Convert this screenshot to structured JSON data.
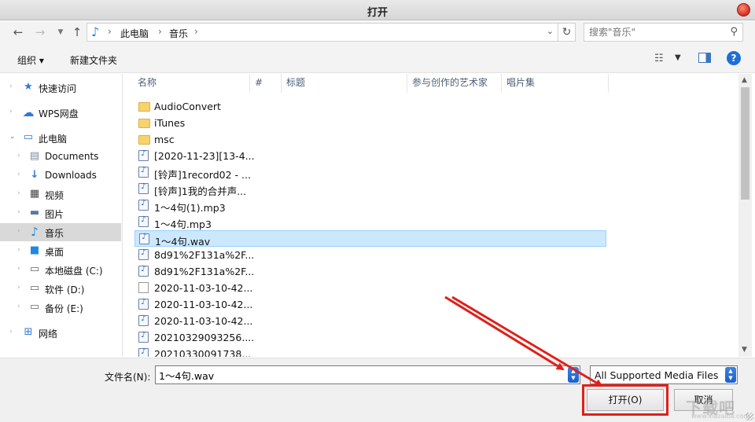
{
  "window": {
    "title": "打开"
  },
  "addressbar": {
    "crumbs": [
      "此电脑",
      "音乐"
    ],
    "search_placeholder": "搜索\"音乐\""
  },
  "toolbar": {
    "organize": "组织 ▾",
    "new_folder": "新建文件夹"
  },
  "nav": {
    "items": [
      {
        "label": "快速访问",
        "icon": "star-icon"
      },
      {
        "label": "WPS网盘",
        "icon": "cloud-icon"
      },
      {
        "label": "此电脑",
        "icon": "computer-icon"
      },
      {
        "label": "Documents",
        "icon": "document-icon"
      },
      {
        "label": "Downloads",
        "icon": "download-icon"
      },
      {
        "label": "视频",
        "icon": "video-icon"
      },
      {
        "label": "图片",
        "icon": "picture-icon"
      },
      {
        "label": "音乐",
        "icon": "music-icon",
        "selected": true
      },
      {
        "label": "桌面",
        "icon": "desktop-icon"
      },
      {
        "label": "本地磁盘 (C:)",
        "icon": "drive-icon"
      },
      {
        "label": "软件 (D:)",
        "icon": "drive-icon"
      },
      {
        "label": "备份 (E:)",
        "icon": "drive-icon"
      },
      {
        "label": "网络",
        "icon": "network-icon"
      }
    ]
  },
  "columns": [
    "名称",
    "#",
    "标题",
    "参与创作的艺术家",
    "唱片集"
  ],
  "files": [
    {
      "name": "AudioConvert",
      "type": "folder"
    },
    {
      "name": "iTunes",
      "type": "folder"
    },
    {
      "name": "msc",
      "type": "folder"
    },
    {
      "name": "[2020-11-23][13-4...",
      "type": "audio"
    },
    {
      "name": "[铃声]1record02 - ...",
      "type": "audio"
    },
    {
      "name": "[铃声]1我的合并声...",
      "type": "audio"
    },
    {
      "name": "1～4句(1).mp3",
      "type": "audio"
    },
    {
      "name": "1～4句.mp3",
      "type": "audio"
    },
    {
      "name": "1～4句.wav",
      "type": "audio",
      "selected": true
    },
    {
      "name": "8d91%2F131a%2F...",
      "type": "audio"
    },
    {
      "name": "8d91%2F131a%2F...",
      "type": "audio"
    },
    {
      "name": "2020-11-03-10-42...",
      "type": "blank"
    },
    {
      "name": "2020-11-03-10-42...",
      "type": "audio"
    },
    {
      "name": "2020-11-03-10-42...",
      "type": "audio"
    },
    {
      "name": "20210329093256....",
      "type": "audio"
    },
    {
      "name": "20210330091738...",
      "type": "audio"
    }
  ],
  "bottom": {
    "filename_label": "文件名(N):",
    "filename_value": "1～4句.wav",
    "filter_value": "All Supported Media Files",
    "open_label": "打开(O)",
    "cancel_label": "取消"
  },
  "watermark": {
    "text": "下载吧",
    "sub": "www.xiazaiba.com"
  },
  "colors": {
    "accent": "#1e88e5",
    "selection": "#cce8ff",
    "annotation_red": "#e0201a"
  }
}
